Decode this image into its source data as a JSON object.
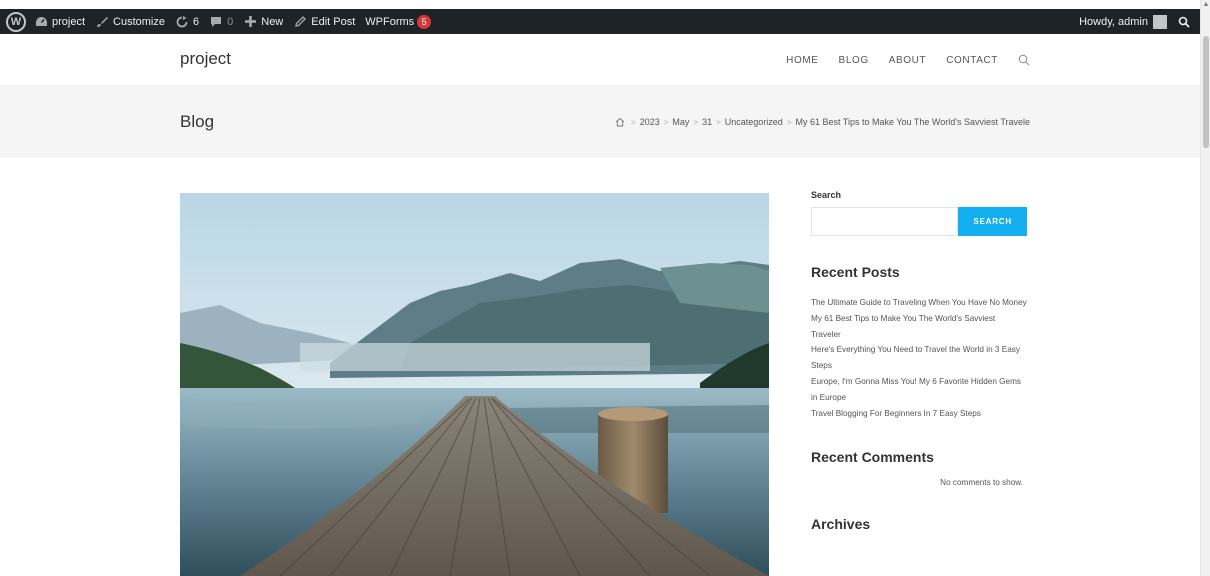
{
  "adminbar": {
    "site_name": "project",
    "customize": "Customize",
    "updates_count": "6",
    "comments_count": "0",
    "new_label": "New",
    "edit_post": "Edit Post",
    "wpforms": "WPForms",
    "wpforms_badge": "5",
    "howdy": "Howdy, admin"
  },
  "header": {
    "site_title": "project",
    "nav": [
      "HOME",
      "BLOG",
      "ABOUT",
      "CONTACT"
    ]
  },
  "page_header": {
    "title": "Blog",
    "breadcrumb": [
      "2023",
      "May",
      "31",
      "Uncategorized",
      "My 61 Best Tips to Make You The World's Savviest Travele"
    ]
  },
  "sidebar": {
    "search_label": "Search",
    "search_placeholder": "",
    "search_button": "SEARCH",
    "recent_posts_title": "Recent Posts",
    "recent_posts": [
      "The Ultimate Guide to Traveling When You Have No Money",
      "My 61 Best Tips to Make You The World's Savviest Traveler",
      "Here's Everything You Need to Travel the World in 3 Easy Steps",
      "Europe, I'm Gonna Miss You! My 6 Favorite Hidden Gems in Europe",
      "Travel Blogging For Beginners In 7 Easy Steps"
    ],
    "recent_comments_title": "Recent Comments",
    "no_comments": "No comments to show.",
    "archives_title": "Archives"
  },
  "colors": {
    "adminbar_bg": "#1d2327",
    "accent": "#13aff0",
    "page_header_bg": "#f5f5f5",
    "badge": "#d63638"
  }
}
